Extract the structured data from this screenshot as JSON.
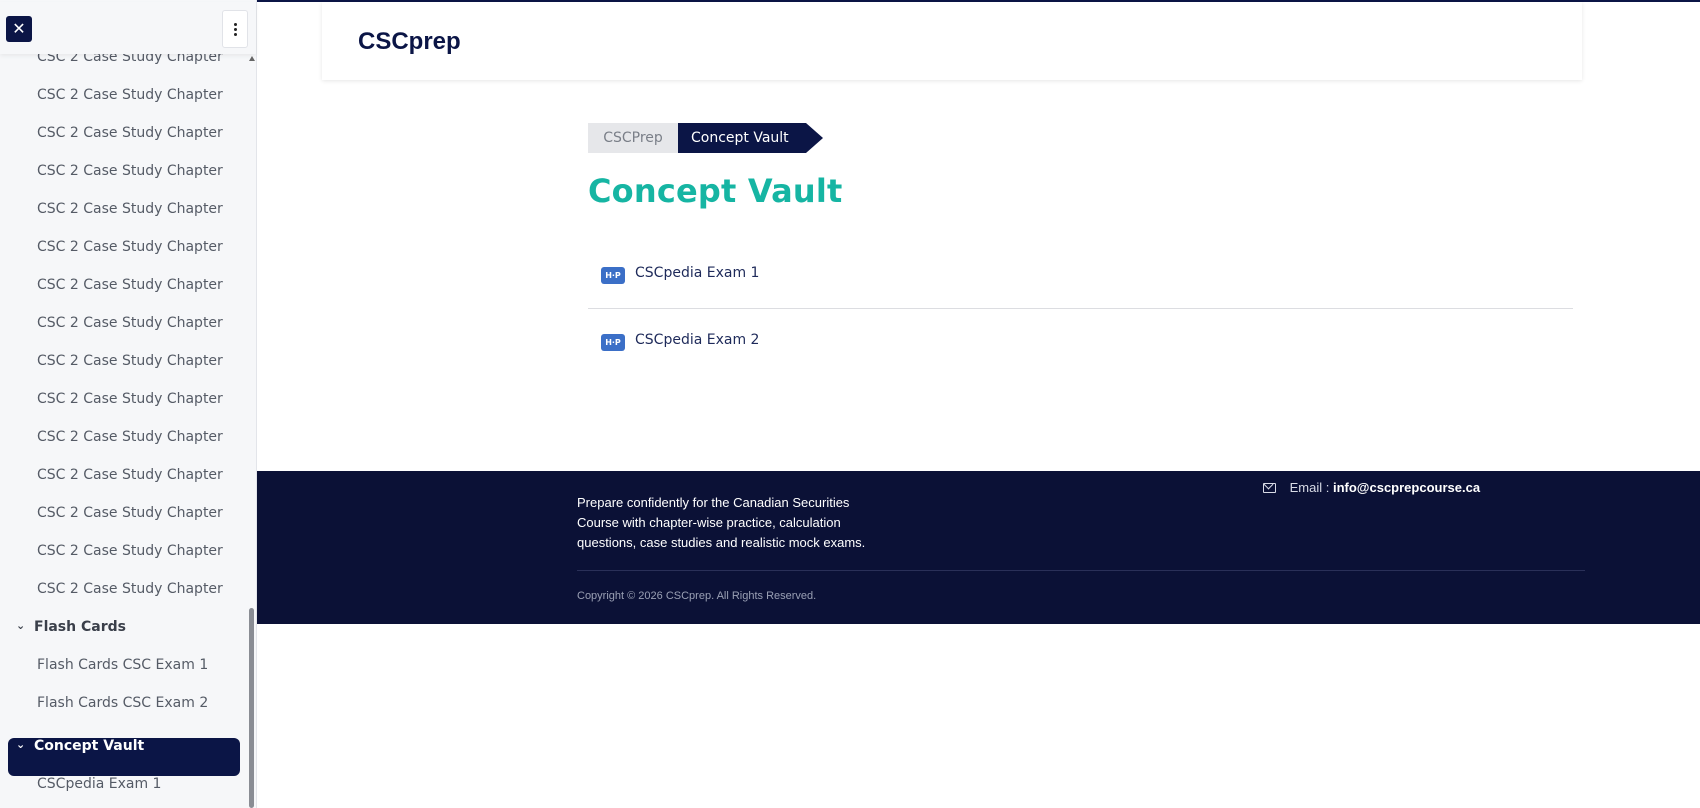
{
  "sidebar": {
    "close_icon": "✕",
    "case_study_items": [
      "CSC 2 Case Study Chapter",
      "CSC 2 Case Study Chapter",
      "CSC 2 Case Study Chapter",
      "CSC 2 Case Study Chapter",
      "CSC 2 Case Study Chapter",
      "CSC 2 Case Study Chapter",
      "CSC 2 Case Study Chapter",
      "CSC 2 Case Study Chapter",
      "CSC 2 Case Study Chapter",
      "CSC 2 Case Study Chapter",
      "CSC 2 Case Study Chapter",
      "CSC 2 Case Study Chapter",
      "CSC 2 Case Study Chapter",
      "CSC 2 Case Study Chapter",
      "CSC 2 Case Study Chapter"
    ],
    "flash_cards": {
      "label": "Flash Cards",
      "items": [
        "Flash Cards CSC Exam 1",
        "Flash Cards CSC Exam 2"
      ]
    },
    "concept_vault": {
      "label": "Concept Vault",
      "items": [
        "CSCpedia Exam 1"
      ]
    }
  },
  "header": {
    "logo": "CSCprep"
  },
  "breadcrumb": {
    "home": "CSCPrep",
    "current": "Concept Vault"
  },
  "main": {
    "title": "Concept Vault",
    "icon_text": "H·P",
    "items": [
      "CSCpedia Exam 1",
      "CSCpedia Exam 2"
    ]
  },
  "footer": {
    "description": "Prepare confidently for the Canadian Securities Course with chapter-wise practice, calculation questions, case studies and realistic mock exams.",
    "email_label": "Email :",
    "email": "info@cscprepcourse.ca",
    "copyright": "Copyright © 2026 CSCprep. All Rights Reserved."
  },
  "colors": {
    "navy": "#0b1546",
    "teal": "#16b5a3",
    "footer_bg": "#0b1136",
    "hp_blue": "#3b6fc7"
  }
}
